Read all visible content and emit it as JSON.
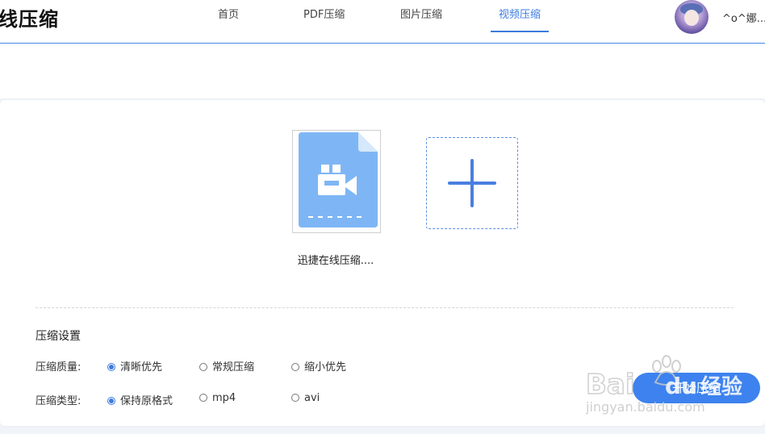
{
  "header": {
    "logo": "线压缩",
    "nav": [
      {
        "label": "首页"
      },
      {
        "label": "PDF压缩"
      },
      {
        "label": "图片压缩"
      },
      {
        "label": "视频压缩"
      }
    ],
    "active_nav": "视频压缩",
    "username": "^o^娜..."
  },
  "upload": {
    "file_name": "迅捷在线压缩...."
  },
  "settings": {
    "title": "压缩设置",
    "quality": {
      "label": "压缩质量:",
      "options": [
        "清晰优先",
        "常规压缩",
        "缩小优先"
      ],
      "selected": "清晰优先"
    },
    "type": {
      "label": "压缩类型:",
      "options": [
        "保持原格式",
        "mp4",
        "avi"
      ],
      "selected": "保持原格式"
    }
  },
  "start_button": "开始压缩",
  "watermark": {
    "brand": "Bai",
    "brand_suffix": "du",
    "brand_cn": "经验",
    "url": "jingyan.baidu.com"
  },
  "colors": {
    "accent": "#3d7be0",
    "file_icon": "#7eb6f5",
    "button": "#3d82ee"
  }
}
